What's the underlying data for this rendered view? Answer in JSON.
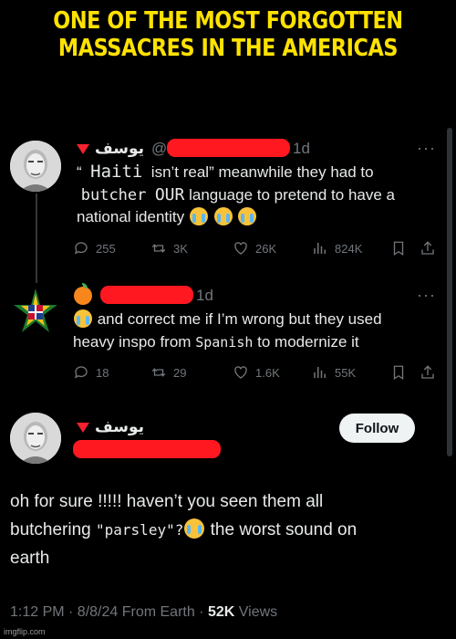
{
  "caption": {
    "line1": "ONE OF THE MOST FORGOTTEN",
    "line2": "MASSACRES IN THE AMERICAS"
  },
  "tweet1": {
    "author_name": "يوسف",
    "handle_prefix": "@",
    "time": "1d",
    "text_segments": [
      "“",
      "Haiti",
      " isn’t real” meanwhile they had to",
      "butcher",
      "OUR",
      " language to pretend to have a",
      "national identity"
    ],
    "replies": "255",
    "retweets": "3K",
    "likes": "26K",
    "views": "824K"
  },
  "tweet2": {
    "time": "1d",
    "text_line1": " and correct me if I’m wrong but they used",
    "text_line2a": "heavy inspo from ",
    "text_line2_mono": "Spanish",
    "text_line2b": " to modernize it",
    "replies": "18",
    "retweets": "29",
    "likes": "1.6K",
    "views": "55K"
  },
  "tweet3": {
    "author_name": "يوسف",
    "follow_label": "Follow",
    "text_line1": "oh for sure !!!!! haven’t you seen them all",
    "text_line2a": "butchering ",
    "text_line2_mono": "\"parsley\"?",
    "text_line2b": " the worst sound on",
    "text_line3": "earth",
    "meta_time": "1:12 PM · 8/8/24 From Earth · ",
    "meta_views": "52K",
    "meta_views_label": " Views"
  },
  "watermark": "imgflip.com",
  "colors": {
    "caption": "#ffe200",
    "redaction": "#ff1820",
    "muted": "#71767b"
  }
}
